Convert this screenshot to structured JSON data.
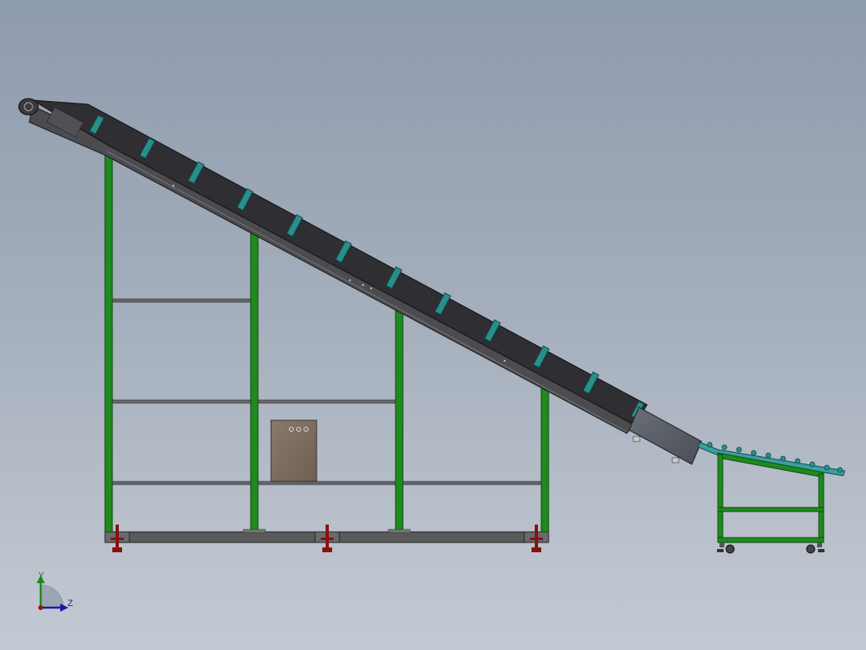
{
  "viewport": {
    "background_top": "#8e9bad",
    "background_bottom": "#c4cad3"
  },
  "colors": {
    "frame_green": "#1f8a1f",
    "frame_green_dark": "#0f5a0f",
    "belt_dark": "#2e2e33",
    "belt_side": "#4b4b50",
    "cleat_teal": "#2a8f8a",
    "base_gray": "#5a5a5c",
    "shelf_gray": "#66666a",
    "control_box": "#7d6d5f",
    "leveling_foot_red": "#8a1010",
    "roller_teal": "#3aa0a0"
  },
  "triad": {
    "y_label": "Y",
    "z_label": "Z",
    "y_axis_icon": "arrow-up-icon",
    "z_axis_icon": "arrow-right-icon"
  }
}
